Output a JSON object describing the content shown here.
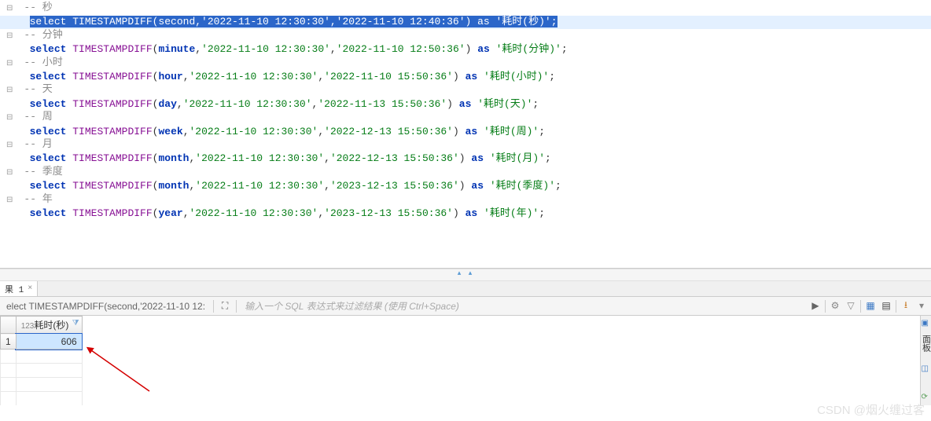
{
  "code": [
    {
      "type": "comment",
      "text": "-- 秒",
      "fold": true
    },
    {
      "type": "sql",
      "highlighted": true,
      "unit": "second",
      "d1": "'2022-11-10 12:30:30'",
      "d2": "'2022-11-10 12:40:36'",
      "alias": "'耗时(秒)'"
    },
    {
      "type": "comment",
      "text": "-- 分钟",
      "fold": true
    },
    {
      "type": "sql",
      "unit": "minute",
      "d1": "'2022-11-10 12:30:30'",
      "d2": "'2022-11-10 12:50:36'",
      "alias": "'耗时(分钟)'"
    },
    {
      "type": "comment",
      "text": "-- 小时",
      "fold": true
    },
    {
      "type": "sql",
      "unit": "hour",
      "d1": "'2022-11-10 12:30:30'",
      "d2": "'2022-11-10 15:50:36'",
      "alias": "'耗时(小时)'"
    },
    {
      "type": "comment",
      "text": "-- 天",
      "fold": true
    },
    {
      "type": "sql",
      "unit": "day",
      "d1": "'2022-11-10 12:30:30'",
      "d2": "'2022-11-13 15:50:36'",
      "alias": "'耗时(天)'"
    },
    {
      "type": "comment",
      "text": "-- 周",
      "fold": true
    },
    {
      "type": "sql",
      "unit": "week",
      "d1": "'2022-11-10 12:30:30'",
      "d2": "'2022-12-13 15:50:36'",
      "alias": "'耗时(周)'"
    },
    {
      "type": "comment",
      "text": "-- 月",
      "fold": true
    },
    {
      "type": "sql",
      "unit": "month",
      "d1": "'2022-11-10 12:30:30'",
      "d2": "'2022-12-13 15:50:36'",
      "alias": "'耗时(月)'"
    },
    {
      "type": "comment",
      "text": "-- 季度",
      "fold": true
    },
    {
      "type": "sql",
      "unit": "month",
      "d1": "'2022-11-10 12:30:30'",
      "d2": "'2023-12-13 15:50:36'",
      "alias": "'耗时(季度)'"
    },
    {
      "type": "comment",
      "text": "-- 年",
      "fold": true
    },
    {
      "type": "sql",
      "unit": "year",
      "d1": "'2022-11-10 12:30:30'",
      "d2": "'2023-12-13 15:50:36'",
      "alias": "'耗时(年)'"
    }
  ],
  "kw_select": "select",
  "kw_as": "as",
  "func": "TIMESTAMPDIFF",
  "tab": {
    "label": "果 1",
    "close": "×"
  },
  "toolbar": {
    "query": "elect TIMESTAMPDIFF(second,'2022-11-10 12:",
    "filter_placeholder": "输入一个 SQL 表达式来过滤结果 (使用 Ctrl+Space)"
  },
  "result": {
    "col_prefix": "123",
    "col_header": "耗时(秒)",
    "row_num": "1",
    "value": "606"
  },
  "side": {
    "label": "面板"
  },
  "watermark": "CSDN @烟火缠过客"
}
